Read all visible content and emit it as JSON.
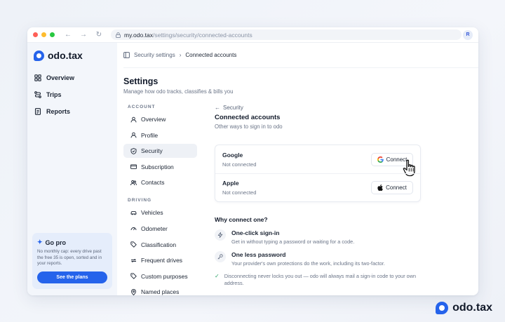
{
  "browser": {
    "url_host": "my.odo.tax",
    "url_path": "/settings/security/connected-accounts",
    "avatar_initial": "R"
  },
  "sidebar": {
    "brand": "odo.tax",
    "items": [
      {
        "label": "Overview",
        "icon": "grid-icon"
      },
      {
        "label": "Trips",
        "icon": "route-icon"
      },
      {
        "label": "Reports",
        "icon": "document-icon"
      }
    ],
    "promo": {
      "title": "Go pro",
      "text": "No monthly cap: every drive past the free 35 is open, sorted and in your reports.",
      "button": "See the plans"
    }
  },
  "breadcrumb": {
    "parent": "Security settings",
    "current": "Connected accounts"
  },
  "page": {
    "title": "Settings",
    "subtitle": "Manage how odo tracks, classifies & bills you"
  },
  "settings_nav": {
    "account_label": "ACCOUNT",
    "account_items": [
      "Overview",
      "Profile",
      "Security",
      "Subscription",
      "Contacts"
    ],
    "driving_label": "DRIVING",
    "driving_items": [
      "Vehicles",
      "Odometer",
      "Classification",
      "Frequent drives",
      "Custom purposes",
      "Named places"
    ]
  },
  "content": {
    "back": "Security",
    "title": "Connected accounts",
    "subtitle": "Other ways to sign in to odo",
    "providers": [
      {
        "name": "Google",
        "status": "Not connected",
        "button": "Connect"
      },
      {
        "name": "Apple",
        "status": "Not connected",
        "button": "Connect"
      }
    ],
    "why_title": "Why connect one?",
    "benefits": [
      {
        "title": "One-click sign-in",
        "text": "Get in without typing a password or waiting for a code."
      },
      {
        "title": "One less password",
        "text": "Your provider's own protections do the work, including its two-factor."
      }
    ],
    "note": "Disconnecting never locks you out — odo will always mail a sign-in code to your own address."
  },
  "footer_brand": "odo.tax",
  "colors": {
    "accent": "#2563eb",
    "success": "#2fa56a"
  }
}
